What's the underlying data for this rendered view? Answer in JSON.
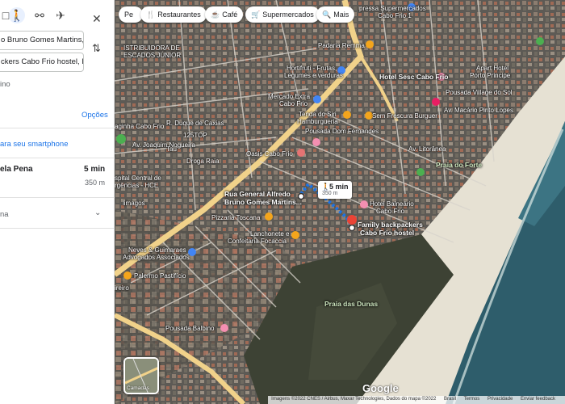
{
  "panel": {
    "origin_value": "o Bruno Gomes Martins, 4",
    "destination_value": "ckers Cabo Frio hostel, R",
    "cutoff_text": "ino",
    "options_label": "Opções",
    "send_label": "ara seu smartphone",
    "route_name": "ela Pena",
    "route_time": "5 min",
    "route_distance": "350 m",
    "route_detail": "na"
  },
  "chips": {
    "search": "Pe",
    "restaurants": "Restaurantes",
    "cafe": "Café",
    "supermarkets": "Supermercados",
    "more": "Mais"
  },
  "map": {
    "labels": {
      "supermercados_line1": "pressa Supermercados",
      "supermercados_line2": "Cabo Frio 1",
      "padaria": "Padaria Remma",
      "hortifruti_line1": "Hortifruti - Frutas,",
      "hortifruti_line2": "Legumes e verduras",
      "hotel_sesc": "Hotel Sesc Cabo Frio",
      "apart_line1": "Apart Hotel",
      "apart_line2": "Porto Principe",
      "mercado_line1": "Mercado Extra",
      "mercado_line2": "Cabo Frio",
      "pousada_village": "Pousada Village do Sol",
      "tenda_line1": "Tenda do Siri",
      "tenda_line2": "Hamburgueria",
      "sem_frescura": "Sem Frescura Burguer",
      "pousada_dom": "Pousada Dom Fernandes",
      "oasis": "Oasis Cabo Frio",
      "droga_raia": "Droga Raia",
      "praia_forte": "Praia do Forte",
      "hotel_balneario_line1": "Hotel Balneário",
      "hotel_balneario_line2": "Cabo Frio",
      "rua_line1": "Rua General Alfredo",
      "rua_line2": "Bruno Gomes Martins...",
      "family_line1": "Family backpackers",
      "family_line2": "Cabo Frio hostel",
      "pizzaria": "Pizzaria Toscana",
      "lanchonete_line1": "Lanchonete e",
      "lanchonete_line2": "Confeitaria Focaccia",
      "neves_line1": "Neves & Guimaraes",
      "neves_line2": "Advogados Associados",
      "palermo": "Palermo Pastifício",
      "praia_dunas": "Praia das Dunas",
      "pousada_balbino": "Pousada Balbino",
      "distrib_line1": "ISTRIBUIDORA DE",
      "distrib_line2": "ESCADOS JÚNIOR",
      "pagina": "aginha Cabo Frio",
      "hospital_line1": "spital Central de",
      "hospital_line2": "rgências - HCE",
      "limagos": "limagos",
      "ireiro": "ireiro",
      "av_joaquim": "Av. Joaquim Nogueira",
      "av_macario": "Av. Macário Pinto Lopes",
      "av_litoranea": "Av. Litorânea",
      "duque": "R. Duque de Caxias",
      "tau": "Tau",
      "tinyb": "125TOP"
    },
    "bubble": {
      "time": "5 min",
      "distance": "350 m"
    },
    "layers_label": "Camadas",
    "google_logo": "Google",
    "attribution": [
      "Imagens ©2022 CNES / Airbus, Maxar Technologies, Dados do mapa ©2022",
      "Brasil",
      "Termos",
      "Privacidade",
      "Enviar feedback"
    ],
    "colors": {
      "route_blue": "#1a73e8",
      "road_yellow": "#f1d28a",
      "ocean": "#2f5f6e",
      "sand": "#e8e3d3",
      "pin_red": "#ea4335"
    }
  }
}
